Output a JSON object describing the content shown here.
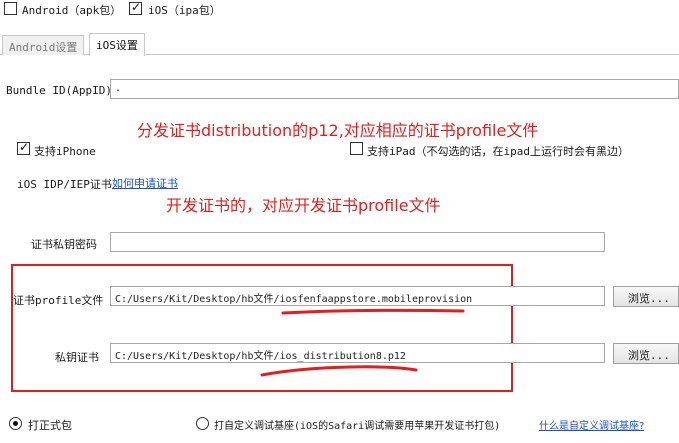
{
  "platforms": {
    "android_label": "Android（apk包）",
    "android_checked": false,
    "ios_label": "iOS（ipa包）",
    "ios_checked": true
  },
  "tabs": [
    {
      "label": "Android设置",
      "active": false
    },
    {
      "label": "iOS设置",
      "active": true
    }
  ],
  "form": {
    "bundle_id_label": "Bundle ID(AppID)",
    "bundle_id_value": ".",
    "support_iphone_label": "支持iPhone",
    "support_iphone_checked": true,
    "support_ipad_label": "支持iPad（不勾选的话，在ipad上运行时会有黑边）",
    "support_ipad_checked": false,
    "cert_label": "iOS IDP/IEP证书",
    "cert_apply_link": "如何申请证书",
    "cert_password_label": "证书私钥密码",
    "cert_password_value": "",
    "profile_label": "证书profile文件",
    "profile_value": "C:/Users/Kit/Desktop/hb文件/iosfenfaappstore.mobileprovision",
    "private_key_label": "私钥证书",
    "private_key_value": "C:/Users/Kit/Desktop/hb文件/ios_distribution8.p12",
    "browse_label": "浏览..."
  },
  "annotations": {
    "distribution_note": "分发证书distribution的p12,对应相应的证书profile文件",
    "dev_note": "开发证书的，对应开发证书profile文件"
  },
  "package_type": {
    "formal_label": "打正式包",
    "formal_selected": true,
    "custom_label": "打自定义调试基座(iOS的Safari调试需要用苹果开发证书打包)",
    "custom_selected": false,
    "custom_link": "什么是自定义调试基座?"
  },
  "colors": {
    "annotation_red": "#e02020",
    "link_blue": "#1a4fd6"
  }
}
